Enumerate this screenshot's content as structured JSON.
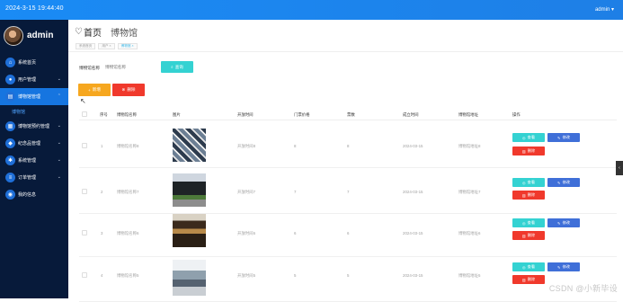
{
  "topbar": {
    "datetime": "2024-3-15 19:44:40",
    "user_menu": "admin ▾"
  },
  "sidebar": {
    "username": "admin",
    "items": [
      {
        "label": "系统首页",
        "icon": "home-icon"
      },
      {
        "label": "用户管理",
        "icon": "user-icon",
        "chevron": "⌄"
      },
      {
        "label": "博物馆管理",
        "icon": "museum-icon",
        "chevron": "⌄",
        "active": true
      },
      {
        "label": "博物馆预约管理",
        "icon": "calendar-icon",
        "chevron": "⌄"
      },
      {
        "label": "纪念品管理",
        "icon": "gift-icon",
        "chevron": "⌄"
      },
      {
        "label": "系统管理",
        "icon": "settings-icon",
        "chevron": "⌄"
      },
      {
        "label": "订单管理",
        "icon": "order-icon",
        "chevron": "⌄"
      },
      {
        "label": "我的信息",
        "icon": "profile-icon"
      }
    ],
    "subitem": "博物馆"
  },
  "header": {
    "title": "首页",
    "subtitle": "博物馆"
  },
  "breadcrumbs": [
    "系统首页",
    "用户 ×",
    "博物馆 ×"
  ],
  "search": {
    "label": "博物馆名称",
    "placeholder": "博物馆名称",
    "button": "查询"
  },
  "actions": {
    "add": "新增",
    "delete": "删除"
  },
  "table": {
    "columns": [
      "序号",
      "博物馆名称",
      "图片",
      "开放时间",
      "门票价格",
      "票数",
      "成立时间",
      "博物馆地址",
      "操作"
    ],
    "rows": [
      {
        "index": "1",
        "name": "博物馆名称8",
        "image": "mosaic",
        "open_time": "开放时间8",
        "price": "8",
        "tickets": "8",
        "established": "2024-03-15",
        "address": "博物馆地址8"
      },
      {
        "index": "2",
        "name": "博物馆名称7",
        "image": "building",
        "open_time": "开放时间7",
        "price": "7",
        "tickets": "7",
        "established": "2024-03-15",
        "address": "博物馆地址7"
      },
      {
        "index": "3",
        "name": "博物馆名称6",
        "image": "hall",
        "open_time": "开放时间6",
        "price": "6",
        "tickets": "6",
        "established": "2024-03-15",
        "address": "博物馆地址6"
      },
      {
        "index": "4",
        "name": "博物馆名称5",
        "image": "street",
        "open_time": "开放时间5",
        "price": "5",
        "tickets": "5",
        "established": "2024-03-15",
        "address": "博物馆地址5"
      }
    ],
    "row_actions": {
      "view": "查看",
      "edit": "修改",
      "delete": "删除"
    }
  },
  "edge_tab": "‹",
  "watermark": "CSDN @小新毕设",
  "colors": {
    "topbar": "#1a8bf5",
    "sidebar": "#071a3a",
    "active_nav": "#1675e0",
    "cyan_button": "#34d2d2",
    "orange_button": "#f6a71f",
    "red_button": "#f0392c",
    "blue_button": "#3f6fd8"
  }
}
